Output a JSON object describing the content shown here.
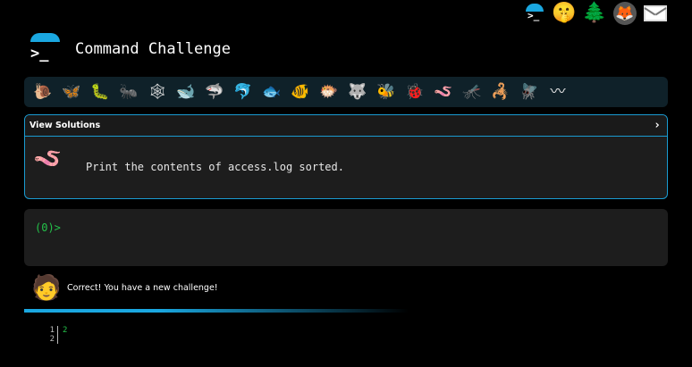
{
  "topbar": {
    "icons": [
      {
        "name": "command-challenge-logo-icon",
        "glyph": ">_"
      },
      {
        "name": "shushing-face-icon",
        "glyph": "🤫"
      },
      {
        "name": "tree-icon",
        "glyph": "🌲"
      },
      {
        "name": "gitlab-icon",
        "glyph": "🦊"
      },
      {
        "name": "mail-icon",
        "glyph": ""
      }
    ]
  },
  "header": {
    "logo_prompt": ">_",
    "title": "Command Challenge"
  },
  "challenges": [
    {
      "name": "snail-icon",
      "glyph": "🐌"
    },
    {
      "name": "butterfly-icon",
      "glyph": "🦋"
    },
    {
      "name": "caterpillar-icon",
      "glyph": "🐛"
    },
    {
      "name": "ant-icon",
      "glyph": "🐜"
    },
    {
      "name": "spider-web-icon",
      "glyph": "🕸"
    },
    {
      "name": "whale-icon",
      "glyph": "🐋"
    },
    {
      "name": "shark-icon",
      "glyph": "🦈"
    },
    {
      "name": "dolphin-icon",
      "glyph": "🐬"
    },
    {
      "name": "fish-icon",
      "glyph": "🐟"
    },
    {
      "name": "tropical-fish-icon",
      "glyph": "🐠"
    },
    {
      "name": "blowfish-icon",
      "glyph": "🐡"
    },
    {
      "name": "wolf-icon",
      "glyph": "🐺"
    },
    {
      "name": "bee-icon",
      "glyph": "🐝"
    },
    {
      "name": "ladybug-icon",
      "glyph": "🐞"
    },
    {
      "name": "worm-icon",
      "glyph": "🪱"
    },
    {
      "name": "mosquito-icon",
      "glyph": "🦟"
    },
    {
      "name": "scorpion-icon",
      "glyph": "🦂"
    },
    {
      "name": "fly-icon",
      "glyph": "🪰"
    },
    {
      "name": "earthworm-icon",
      "glyph": "〰"
    }
  ],
  "panel": {
    "header_label": "View Solutions",
    "chevron": "›",
    "challenge_icon": "🪱",
    "challenge_text": "Print the contents of access.log sorted."
  },
  "terminal": {
    "prompt": "(0)>"
  },
  "result": {
    "avatar": "🧑",
    "message": "Correct! You have a new challenge!"
  },
  "output": {
    "line_numbers": [
      "1",
      "2"
    ],
    "lines": [
      "2",
      ""
    ]
  },
  "colors": {
    "accent": "#1aa7e0",
    "prompt_green": "#24c24a",
    "panel_bg": "#1d1d1d",
    "bar_bg": "#0f2129"
  }
}
